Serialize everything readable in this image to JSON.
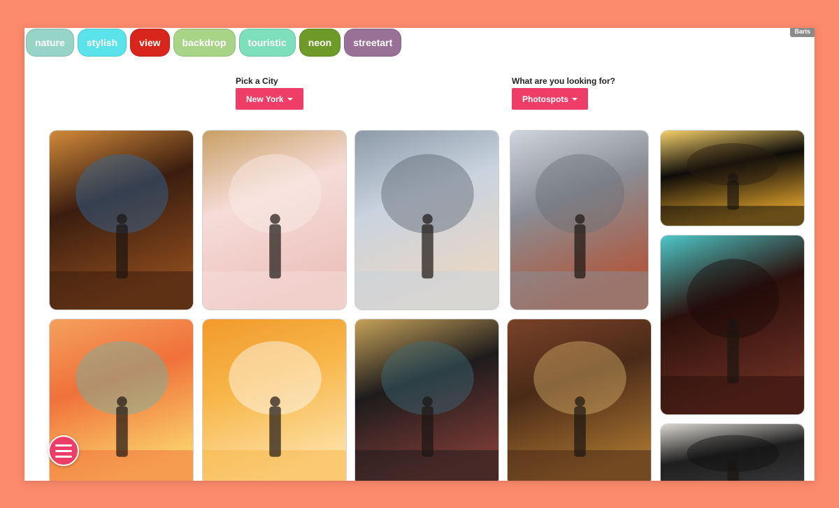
{
  "user": {
    "name": "Baris"
  },
  "tags": [
    {
      "label": "nature",
      "color": "#97d4c8"
    },
    {
      "label": "stylish",
      "color": "#5be3ec"
    },
    {
      "label": "view",
      "color": "#d8261c"
    },
    {
      "label": "backdrop",
      "color": "#a8d487"
    },
    {
      "label": "touristic",
      "color": "#7ddfbc"
    },
    {
      "label": "neon",
      "color": "#6e9a27"
    },
    {
      "label": "streetart",
      "color": "#9a7196"
    }
  ],
  "city": {
    "label": "Pick a City",
    "value": "New York"
  },
  "looking": {
    "label": "What are you looking for?",
    "value": "Photospots"
  },
  "accent_color": "#ee3d67",
  "photos": [
    {
      "name": "photo-church-interior",
      "palette": [
        "#3a1d0f",
        "#8a4a1c",
        "#d38a3a",
        "#2f6ba0"
      ]
    },
    {
      "name": "photo-pink-swing-lounge",
      "palette": [
        "#f6dcd8",
        "#ecc1bd",
        "#c9a065",
        "#fbeee8"
      ]
    },
    {
      "name": "photo-glass-skyline-ledge",
      "palette": [
        "#c9d3df",
        "#e9d7c4",
        "#8d9aa8",
        "#5c6470"
      ]
    },
    {
      "name": "photo-manhattan-bridge-street",
      "palette": [
        "#8a8d94",
        "#b0573c",
        "#cfd5dd",
        "#6b6f75"
      ]
    },
    {
      "name": "photo-carousel-night",
      "palette": [
        "#0e0c09",
        "#d59a2a",
        "#f5d06a",
        "#2a1d10"
      ]
    },
    {
      "name": "photo-rainbow-arches",
      "palette": [
        "#f0713a",
        "#fbd16b",
        "#f4a15d",
        "#6ab3a7"
      ]
    },
    {
      "name": "photo-yellow-butterfly-wings",
      "palette": [
        "#f7b648",
        "#fde0a4",
        "#f19a2b",
        "#ffffff"
      ]
    },
    {
      "name": "photo-graffiti-wall",
      "palette": [
        "#1d1b1c",
        "#7a3b35",
        "#c6a25a",
        "#3e6c7b"
      ]
    },
    {
      "name": "photo-library-ornate-ceiling",
      "palette": [
        "#4a2a18",
        "#a3702e",
        "#7a4228",
        "#d8b06a"
      ]
    },
    {
      "name": "photo-candlelit-pool-hall",
      "palette": [
        "#2b100c",
        "#6a2e22",
        "#4dc8c8",
        "#1a0906"
      ]
    },
    {
      "name": "photo-chandelier-hall",
      "palette": [
        "#1f1e1f",
        "#3c3b3d",
        "#d9d6cf",
        "#0f0f10"
      ]
    }
  ]
}
